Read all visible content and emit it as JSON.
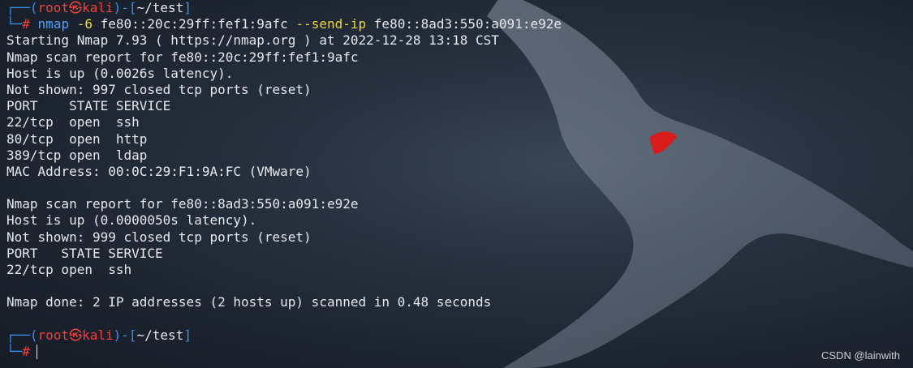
{
  "prompt": {
    "top_frame": "┌──(",
    "user": "root",
    "at_symbol": "㉿",
    "host": "kali",
    "mid_frame": ")-[",
    "path": "~/test",
    "end_bracket": "]",
    "bottom_frame": "└─",
    "hash": "#"
  },
  "command": {
    "program": "nmap",
    "flag1": "-6",
    "arg1": "fe80::20c:29ff:fef1:9afc",
    "flag2": "--send-ip",
    "arg2": "fe80::8ad3:550:a091:e92e"
  },
  "output_lines": [
    "Starting Nmap 7.93 ( https://nmap.org ) at 2022-12-28 13:18 CST",
    "Nmap scan report for fe80::20c:29ff:fef1:9afc",
    "Host is up (0.0026s latency).",
    "Not shown: 997 closed tcp ports (reset)",
    "PORT    STATE SERVICE",
    "22/tcp  open  ssh",
    "80/tcp  open  http",
    "389/tcp open  ldap",
    "MAC Address: 00:0C:29:F1:9A:FC (VMware)",
    "",
    "Nmap scan report for fe80::8ad3:550:a091:e92e",
    "Host is up (0.0000050s latency).",
    "Not shown: 999 closed tcp ports (reset)",
    "PORT   STATE SERVICE",
    "22/tcp open  ssh",
    "",
    "Nmap done: 2 IP addresses (2 hosts up) scanned in 0.48 seconds",
    ""
  ],
  "watermark": "CSDN @lainwith"
}
